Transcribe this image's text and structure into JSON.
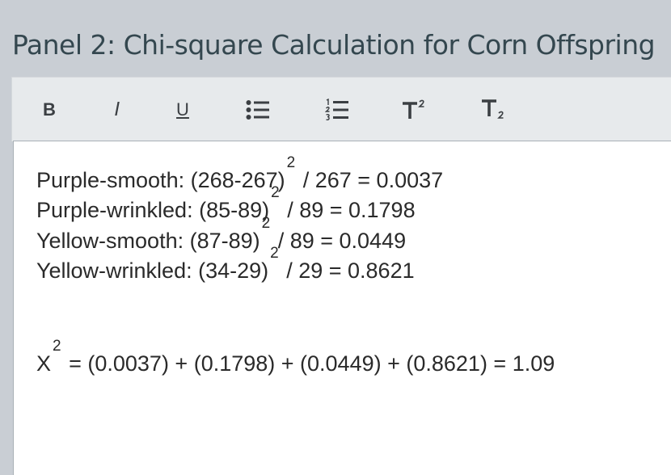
{
  "panel": {
    "title": "Panel 2: Chi-square Calculation for Corn Offspring"
  },
  "toolbar": {
    "bold_label": "B",
    "italic_label": "I",
    "underline_label": "U",
    "bulleted_list_icon": "bulleted-list-icon",
    "numbered_list_icon": "numbered-list-icon",
    "superscript_icon": "superscript-icon",
    "subscript_icon": "subscript-icon"
  },
  "content": {
    "lines": [
      {
        "pre": "Purple-smooth: (268-267)",
        "exp": "2",
        "post": " / 267 = 0.0037"
      },
      {
        "pre": "Purple-wrinkled: (85-89)",
        "exp": "2",
        "post": " / 89 = 0.1798"
      },
      {
        "pre": "Yellow-smooth: (87-89)",
        "exp": "2",
        "post": " / 89 = 0.0449"
      },
      {
        "pre": "Yellow-wrinkled: (34-29)",
        "exp": "2",
        "post": " / 29 = 0.8621"
      }
    ],
    "total": {
      "pre": "X",
      "exp": "2",
      "post": " = (0.0037) + (0.1798) + (0.0449) + (0.8621) = 1.09"
    }
  }
}
